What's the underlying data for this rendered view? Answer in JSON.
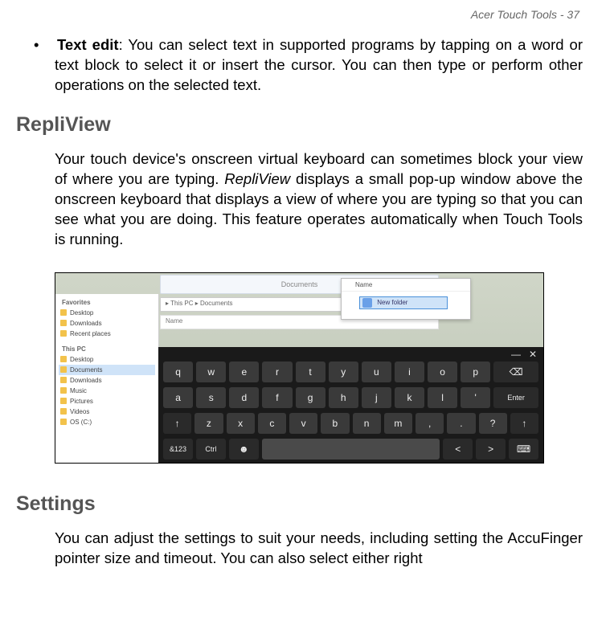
{
  "header": "Acer Touch Tools - 37",
  "bullet": {
    "label": "Text edit",
    "text": ": You can select text in supported programs by tapping on a word or text block to select it or insert the cursor. You can then type or perform other operations on the selected text."
  },
  "section1": {
    "title": "RepliView",
    "para_before": "Your touch device's onscreen virtual keyboard can sometimes block your view of where you are typing. ",
    "italic": "RepliView",
    "para_after": " displays a small pop-up window above the onscreen keyboard that displays a view of where you are typing so that you can see what you are doing. This feature operates automatically when Touch Tools is running."
  },
  "figure": {
    "titlebar": "Documents",
    "pathbar": "▸ This PC ▸ Documents",
    "listhdr": "Name",
    "popup_label": "Name",
    "popup_value": "New folder",
    "sidebar": {
      "fav_hdr": "Favorites",
      "fav": [
        "Desktop",
        "Downloads",
        "Recent places"
      ],
      "pc_hdr": "This PC",
      "pc": [
        "Desktop",
        "Documents",
        "Downloads",
        "Music",
        "Pictures",
        "Videos",
        "OS (C:)"
      ]
    },
    "keyboard": {
      "minimize": "—",
      "close": "✕",
      "row1": [
        "q",
        "w",
        "e",
        "r",
        "t",
        "y",
        "u",
        "i",
        "o",
        "p"
      ],
      "row1_back": "⌫",
      "row2": [
        "a",
        "s",
        "d",
        "f",
        "g",
        "h",
        "j",
        "k",
        "l",
        "'"
      ],
      "row2_enter": "Enter",
      "row3_shiftL": "↑",
      "row3": [
        "z",
        "x",
        "c",
        "v",
        "b",
        "n",
        "m",
        ",",
        "."
      ],
      "row3_q": "?",
      "row3_shiftR": "↑",
      "row4": {
        "sym": "&123",
        "ctrl": "Ctrl",
        "smile": "☻",
        "space": "",
        "left": "<",
        "right": ">",
        "kb": "⌨"
      }
    }
  },
  "section2": {
    "title": "Settings",
    "para": "You can adjust the settings to suit your needs, including setting the AccuFinger pointer size and timeout. You can also select either right"
  }
}
